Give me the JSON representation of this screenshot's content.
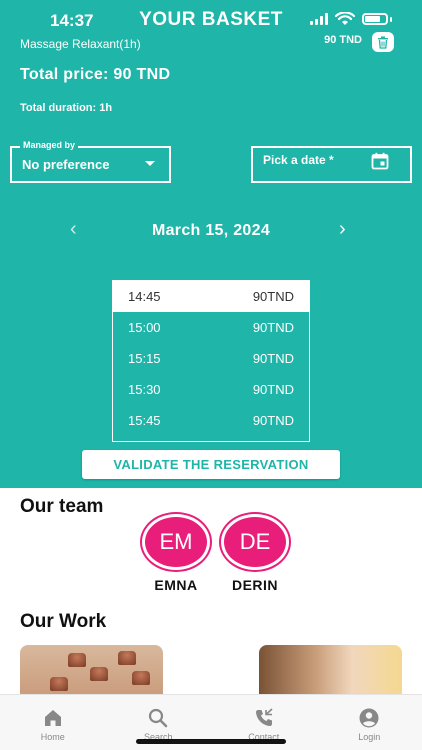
{
  "status_bar": {
    "time": "14:37"
  },
  "header": {
    "title": "YOUR BASKET"
  },
  "basket": {
    "item_name": "Massage Relaxant(1h)",
    "item_price": "90 TND",
    "total_price": "Total price: 90 TND",
    "total_duration": "Total duration: 1h"
  },
  "filters": {
    "managed_by_label": "Managed by",
    "managed_by_value": "No preference",
    "date_placeholder": "Pick a date *"
  },
  "date_nav": {
    "current_date": "March 15, 2024"
  },
  "time_slots": [
    {
      "time": "14:45",
      "price": "90TND",
      "selected": true
    },
    {
      "time": "15:00",
      "price": "90TND",
      "selected": false
    },
    {
      "time": "15:15",
      "price": "90TND",
      "selected": false
    },
    {
      "time": "15:30",
      "price": "90TND",
      "selected": false
    },
    {
      "time": "15:45",
      "price": "90TND",
      "selected": false
    }
  ],
  "validate_button": "VALIDATE THE RESERVATION",
  "team": {
    "title": "Our team",
    "members": [
      {
        "initials": "EM",
        "name": "EMNA"
      },
      {
        "initials": "DE",
        "name": "DERIN"
      }
    ]
  },
  "work": {
    "title": "Our Work"
  },
  "tabbar": {
    "items": [
      {
        "label": "Home",
        "icon": "home-icon"
      },
      {
        "label": "Search",
        "icon": "search-icon"
      },
      {
        "label": "Contact",
        "icon": "phone-icon"
      },
      {
        "label": "Login",
        "icon": "account-icon"
      }
    ]
  },
  "colors": {
    "primary": "#1fb5a8",
    "avatar": "#e91e7a",
    "tab_icon": "#888888"
  }
}
